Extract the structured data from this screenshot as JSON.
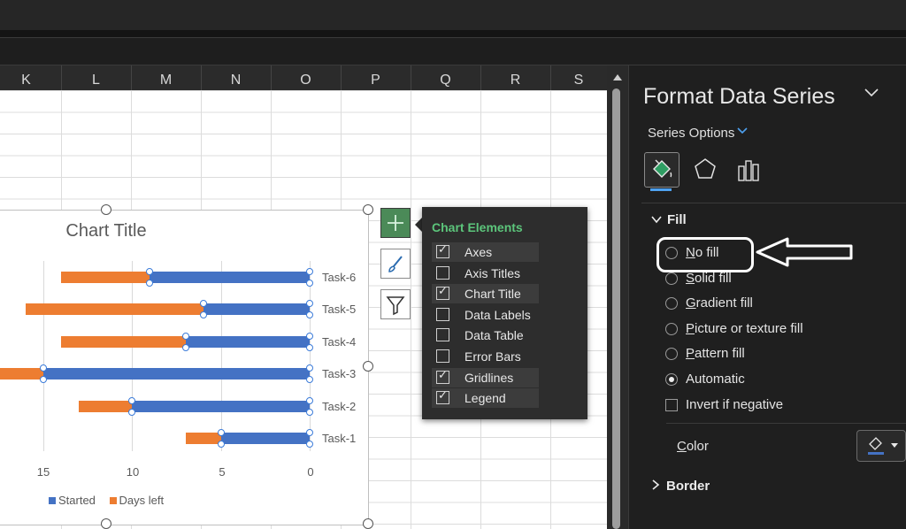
{
  "columns": [
    "K",
    "L",
    "M",
    "N",
    "O",
    "P",
    "Q",
    "R",
    "S"
  ],
  "chart": {
    "title": "Chart Title",
    "tasks": [
      "Task-6",
      "Task-5",
      "Task-4",
      "Task-3",
      "Task-2",
      "Task-1"
    ],
    "x_ticks": [
      "15",
      "10",
      "5",
      "0"
    ],
    "legend": {
      "started": "Started",
      "days_left": "Days left"
    }
  },
  "chart_data": {
    "type": "bar",
    "orientation": "horizontal",
    "stacked": true,
    "x_reversed": true,
    "categories": [
      "Task-1",
      "Task-2",
      "Task-3",
      "Task-4",
      "Task-5",
      "Task-6"
    ],
    "series": [
      {
        "name": "Started",
        "color": "#4472c4",
        "values": [
          5,
          10,
          15,
          7,
          6,
          9
        ]
      },
      {
        "name": "Days left",
        "color": "#ed7d31",
        "values": [
          2,
          3,
          5,
          7,
          10,
          5
        ]
      }
    ],
    "xlim": [
      0,
      17
    ],
    "x_ticks": [
      15,
      10,
      5,
      0
    ],
    "title": "Chart Title",
    "legend_position": "bottom",
    "grid": true
  },
  "chart_elements": {
    "title": "Chart Elements",
    "items": [
      {
        "label": "Axes",
        "checked": true
      },
      {
        "label": "Axis Titles",
        "checked": false
      },
      {
        "label": "Chart Title",
        "checked": true
      },
      {
        "label": "Data Labels",
        "checked": false
      },
      {
        "label": "Data Table",
        "checked": false
      },
      {
        "label": "Error Bars",
        "checked": false
      },
      {
        "label": "Gridlines",
        "checked": true
      },
      {
        "label": "Legend",
        "checked": true
      }
    ]
  },
  "pane": {
    "title": "Format Data Series",
    "series_options": "Series Options",
    "fill_heading": "Fill",
    "fill_options": [
      {
        "key": "N",
        "rest": "o fill",
        "selected": false
      },
      {
        "key": "S",
        "rest": "olid fill",
        "selected": false
      },
      {
        "key": "G",
        "rest": "radient fill",
        "selected": false
      },
      {
        "key": "P",
        "rest": "icture or texture fill",
        "selected": false
      },
      {
        "key": "P",
        "rest": "attern fill",
        "selected": false
      },
      {
        "key": "",
        "rest": "Automatic",
        "selected": true
      }
    ],
    "invert_label": "Invert if negative",
    "color_key": "C",
    "color_rest": "olor",
    "border_heading": "Border",
    "accent": "#4ea1f0"
  }
}
